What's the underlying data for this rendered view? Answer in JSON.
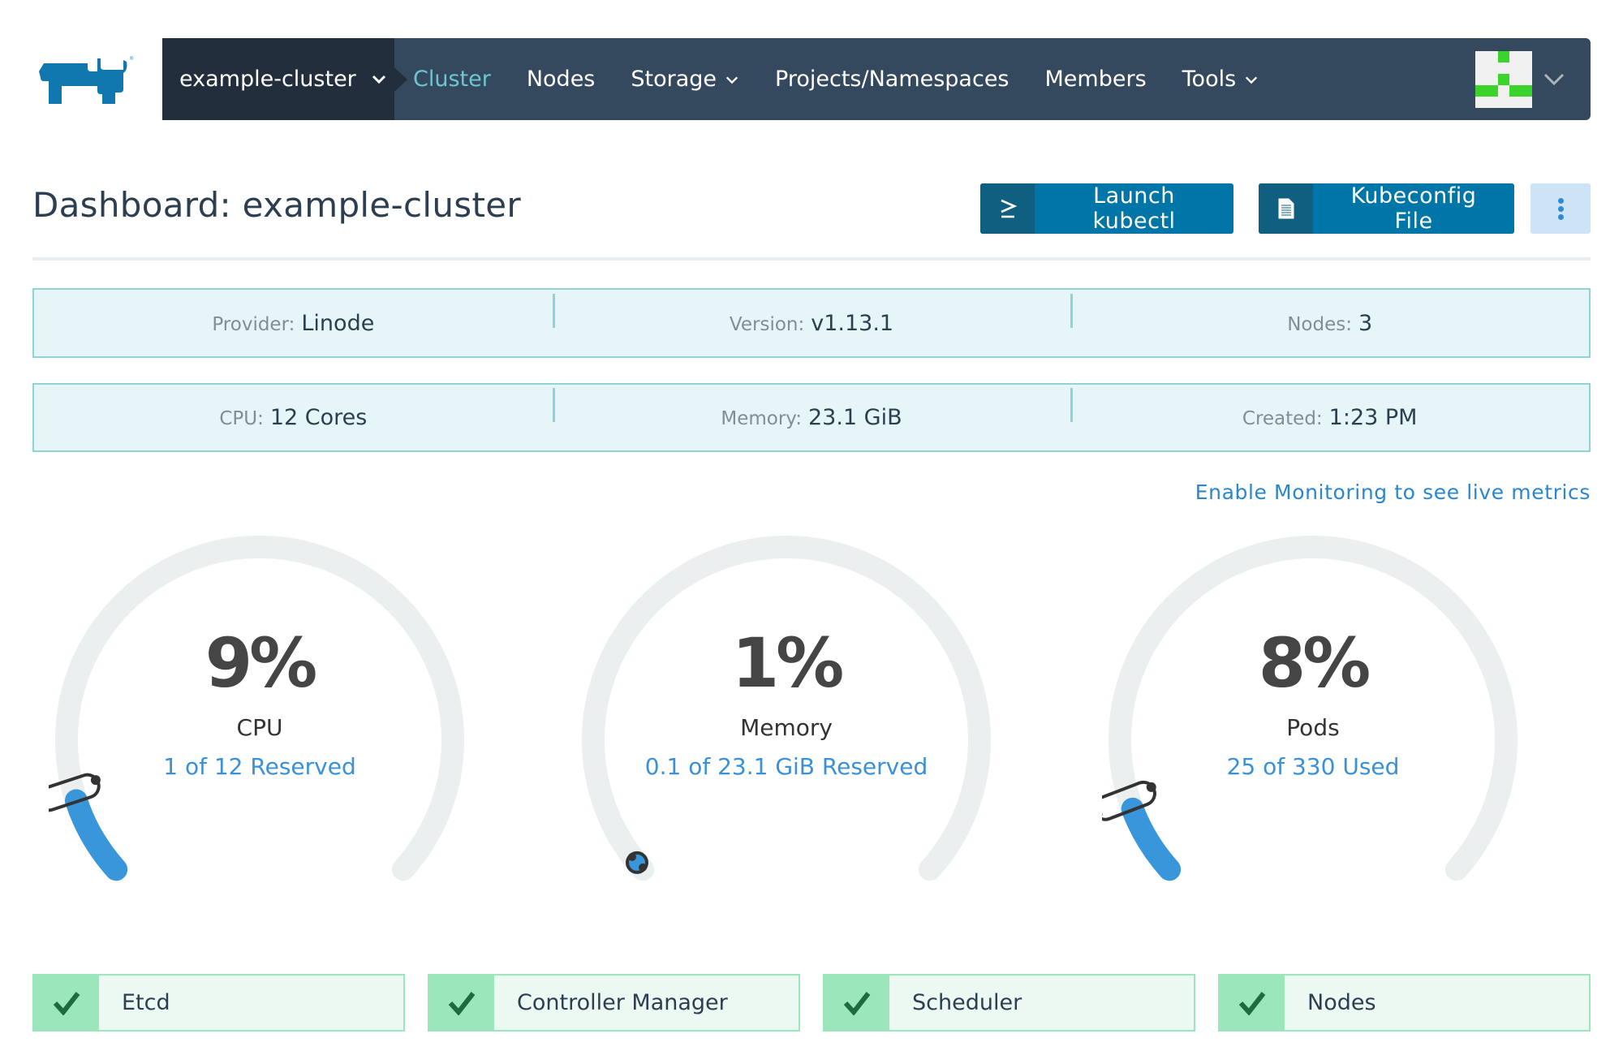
{
  "header": {
    "logo": "rancher-logo",
    "cluster_switcher": {
      "label": "example-cluster"
    },
    "nav": [
      {
        "label": "Cluster",
        "active": true,
        "dropdown": false
      },
      {
        "label": "Nodes",
        "active": false,
        "dropdown": false
      },
      {
        "label": "Storage",
        "active": false,
        "dropdown": true
      },
      {
        "label": "Projects/Namespaces",
        "active": false,
        "dropdown": false
      },
      {
        "label": "Members",
        "active": false,
        "dropdown": false
      },
      {
        "label": "Tools",
        "active": false,
        "dropdown": true
      }
    ],
    "user_menu": {
      "avatar": "identicon-green"
    }
  },
  "page": {
    "title": "Dashboard: example-cluster",
    "actions": {
      "kubectl": {
        "label": "Launch kubectl",
        "icon": "terminal-icon"
      },
      "kubeconfig": {
        "label": "Kubeconfig File",
        "icon": "file-icon"
      },
      "more": {
        "icon": "kebab-icon"
      }
    }
  },
  "info": {
    "row1": [
      {
        "key": "Provider:",
        "value": "Linode"
      },
      {
        "key": "Version:",
        "value": "v1.13.1"
      },
      {
        "key": "Nodes:",
        "value": "3"
      }
    ],
    "row2": [
      {
        "key": "CPU:",
        "value": "12 Cores"
      },
      {
        "key": "Memory:",
        "value": "23.1 GiB"
      },
      {
        "key": "Created:",
        "value": "1:23 PM"
      }
    ]
  },
  "monitoring_link": "Enable Monitoring to see live metrics",
  "gauges": [
    {
      "percent_label": "9%",
      "name": "CPU",
      "detail": "1 of 12 Reserved",
      "value": 0.09,
      "used": 1,
      "total": 12
    },
    {
      "percent_label": "1%",
      "name": "Memory",
      "detail": "0.1 of 23.1 GiB Reserved",
      "value": 0.01,
      "used": 0.1,
      "total": 23.1
    },
    {
      "percent_label": "8%",
      "name": "Pods",
      "detail": "25 of 330 Used",
      "value": 0.08,
      "used": 25,
      "total": 330
    }
  ],
  "components": [
    {
      "name": "Etcd",
      "status": "healthy"
    },
    {
      "name": "Controller Manager",
      "status": "healthy"
    },
    {
      "name": "Scheduler",
      "status": "healthy"
    },
    {
      "name": "Nodes",
      "status": "healthy"
    }
  ],
  "colors": {
    "nav_bg": "#34495e",
    "nav_dark": "#232e3c",
    "accent": "#0075a8",
    "active_nav": "#6ec5d1",
    "gauge_fill": "#3a96db",
    "gauge_track": "#ebeff0",
    "status_ok": "#9ce6bc",
    "check": "#1e6b41"
  }
}
